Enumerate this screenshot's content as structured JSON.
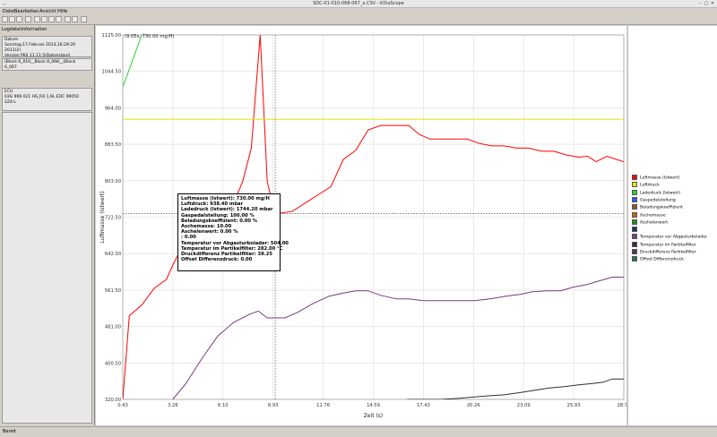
{
  "window": {
    "title": "SDC-01-010-068-067_a.CSV - KDiaScope"
  },
  "menu": [
    "Datei",
    "Bearbeiten",
    "Ansicht",
    "Hilfe"
  ],
  "left_panel": {
    "heading": "Logdateiinformation",
    "box1": "Datum\nSonntag,17.Februar 2013,16:29:20 2013(2)\nVersion PKS 11.11.5(Datenstand\n20130311)",
    "box2": "(Block 6_010__Block 8_068__(Block\n6_067",
    "box3": "ECU\n03G 906 021 HS_R4 1,9L EDC 00050\n2Z4-L"
  },
  "status_text": "Bereit",
  "colors": {
    "luftmasse": "#ff0000",
    "luftdruck": "#e6e600",
    "ladedruck": "#33cc33",
    "gaspedal": "#3355ff",
    "beladung": "#8a5a2a",
    "aschemasse": "#cc6600",
    "aschelen": "#228b22",
    "unnamed": "#1a3366",
    "temp_vor": "#7a3a7a",
    "temp_im": "#3a2a3a",
    "diff": "#553355",
    "offset": "#2a6a5a",
    "grid": "#dcdcdc",
    "cursor": "#333333"
  },
  "legend": [
    {
      "label": "Luftmasse (Istwert)",
      "color": "#ff0000"
    },
    {
      "label": "Luftdruck",
      "color": "#e6e600"
    },
    {
      "label": "Ladedruck (Istwert)",
      "color": "#33cc33"
    },
    {
      "label": "Gaspedalstellung",
      "color": "#3355ff"
    },
    {
      "label": "Beladungskoeffizient",
      "color": "#8a5a2a"
    },
    {
      "label": "Aschemasse",
      "color": "#cc6600"
    },
    {
      "label": "Aschelenwert",
      "color": "#228b22"
    },
    {
      "label": "",
      "color": "#1a3366"
    },
    {
      "label": "Temperatur vor Abgasturbolader",
      "color": "#7a3a7a"
    },
    {
      "label": "Temperatur im Partikelfilter",
      "color": "#3a2a3a"
    },
    {
      "label": "Druckdifferenz Partikelfilter",
      "color": "#553355"
    },
    {
      "label": "Offset Differenzdruck",
      "color": "#2a6a5a"
    }
  ],
  "tooltip": [
    "Luftmasse (Istwert): 730.00  mg/H",
    "Luftdruck: 938.40  mbar",
    "Ladedruck (Istwert): 1744.20  mbar",
    "Gaspedalstellung: 100.00  %",
    "Beladungskoeffizient: 0.00  %",
    "Aschemasse: 10.00",
    "Aschelenwert: 0.00  %",
    "  : 0.00",
    "Temperatur vor Abgasturbolader: 504.00",
    "Temperatur im Partikelfilter: 282.00 °C",
    "Druckdifferenz Partikelfilter: 38.25",
    "Offset Differenzdruck: 0.00"
  ],
  "chart_data": {
    "type": "line",
    "readout": "(9.05s, 730.00 mg/H)",
    "xlabel": "Zeit (s)",
    "ylabel": "Luftmasse (Istwert)",
    "xlim": [
      0.43,
      28.76
    ],
    "ylim": [
      320.0,
      1125.0
    ],
    "x_ticks": [
      "0.43",
      "3.26",
      "6.10",
      "8.93",
      "11.76",
      "14.59",
      "17.43",
      "20.26",
      "23.09",
      "25.93",
      "28.76"
    ],
    "y_ticks": [
      "320.00",
      "400.50",
      "481.00",
      "561.50",
      "642.00",
      "722.50",
      "803.00",
      "883.50",
      "964.00",
      "1044.50",
      "1125.00"
    ],
    "cursor": {
      "x": 9.05,
      "y": 730.0
    },
    "series": [
      {
        "name": "Luftmasse (Istwert)",
        "color": "#ff0000",
        "x": [
          0.43,
          0.8,
          1.5,
          2.2,
          2.9,
          3.3,
          3.7,
          4.3,
          5.0,
          5.8,
          6.6,
          7.2,
          7.7,
          8.2,
          8.6,
          9.05,
          10.0,
          10.8,
          11.6,
          12.2,
          12.9,
          13.6,
          14.3,
          15.0,
          15.8,
          16.6,
          17.2,
          17.8,
          18.5,
          19.2,
          19.9,
          20.6,
          21.3,
          22.0,
          22.7,
          23.4,
          24.1,
          24.8,
          25.5,
          26.2,
          26.7,
          27.2,
          27.8,
          28.76
        ],
        "y": [
          320,
          505,
          528,
          565,
          585,
          620,
          650,
          668,
          672,
          675,
          745,
          800,
          875,
          1125,
          800,
          730,
          735,
          755,
          775,
          790,
          850,
          870,
          915,
          925,
          925,
          925,
          905,
          895,
          895,
          895,
          895,
          885,
          880,
          880,
          875,
          875,
          868,
          868,
          860,
          855,
          857,
          845,
          857,
          845
        ]
      },
      {
        "name": "Luftdruck",
        "color": "#e6e600",
        "x": [
          0.43,
          28.76
        ],
        "y": [
          938.4,
          938.4
        ]
      },
      {
        "name": "Ladedruck (Istwert)",
        "color": "#33cc33",
        "x": [
          0.43,
          0.9,
          1.5
        ],
        "y": [
          1010,
          1060,
          1125
        ]
      },
      {
        "name": "Temperatur vor Abgasturbolader",
        "color": "#7a3a7a",
        "x": [
          3.26,
          4.0,
          4.9,
          5.8,
          6.7,
          7.6,
          8.1,
          8.6,
          9.05,
          9.6,
          10.3,
          11.2,
          12.1,
          12.9,
          13.6,
          14.3,
          15.0,
          15.9,
          16.6,
          17.4,
          18.4,
          19.4,
          20.3,
          21.2,
          22.1,
          22.9,
          23.6,
          24.4,
          25.2,
          25.9,
          26.7,
          27.4,
          28.1,
          28.76
        ],
        "y": [
          320,
          355,
          410,
          460,
          490,
          508,
          515,
          500,
          500,
          500,
          512,
          532,
          548,
          555,
          560,
          560,
          550,
          542,
          542,
          538,
          538,
          538,
          538,
          542,
          548,
          552,
          558,
          560,
          560,
          568,
          574,
          582,
          590,
          590
        ]
      },
      {
        "name": "Temperatur im Partikelfilter",
        "color": "#3a2a3a",
        "x": [
          16.5,
          17.4,
          18.4,
          19.3,
          20.2,
          21.1,
          22.0,
          22.9,
          23.7,
          24.5,
          25.4,
          26.2,
          27.0,
          27.6,
          28.1,
          28.76
        ],
        "y": [
          320,
          320,
          320,
          322,
          325,
          328,
          330,
          335,
          340,
          345,
          348,
          352,
          355,
          358,
          365,
          365
        ]
      }
    ]
  }
}
